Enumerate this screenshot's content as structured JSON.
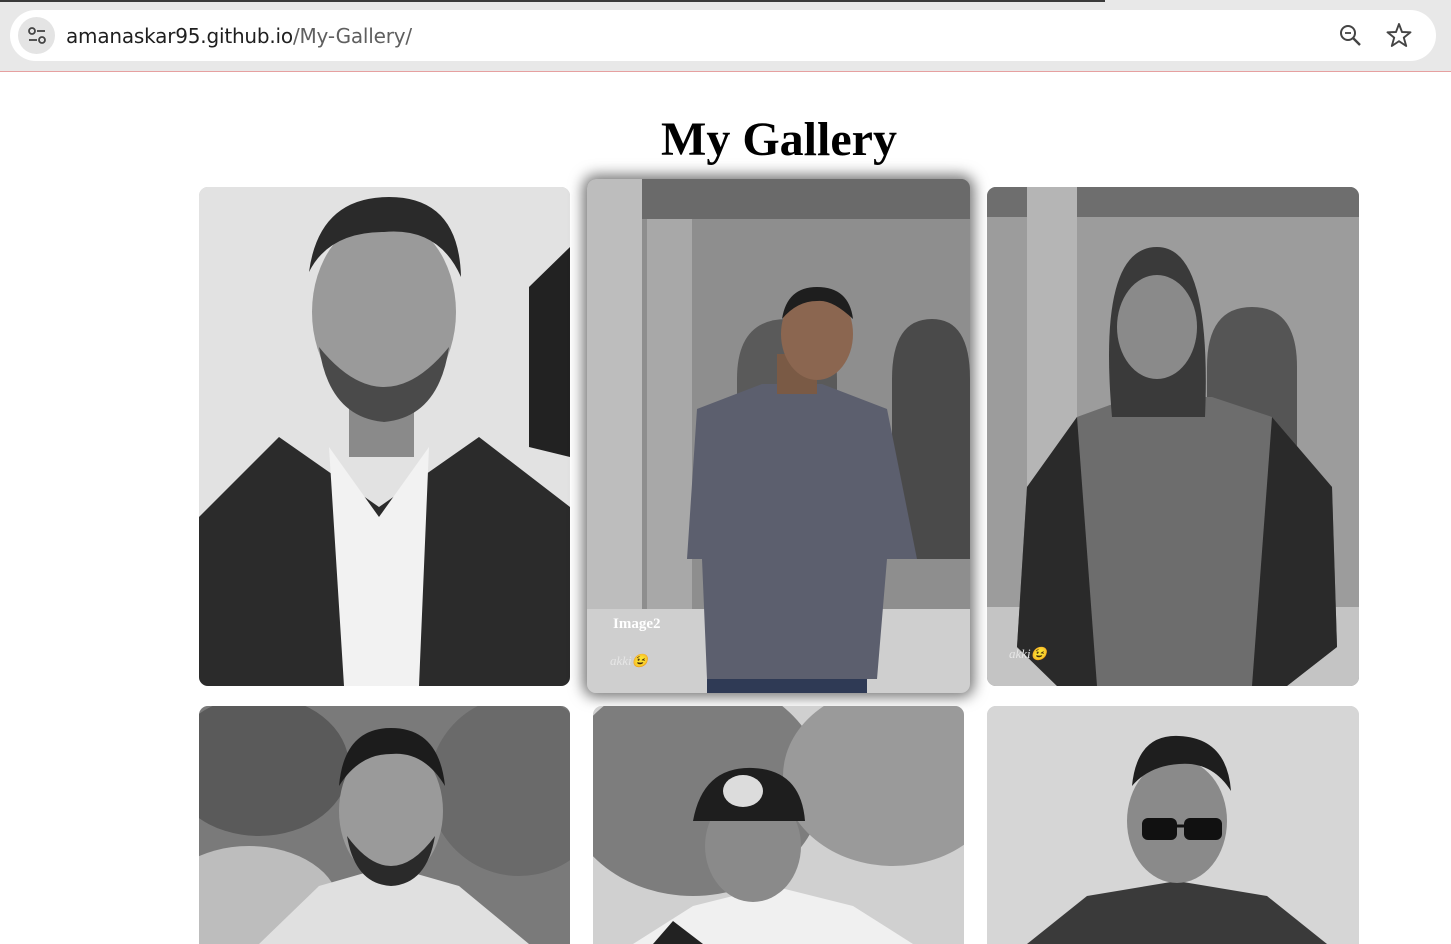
{
  "browser": {
    "url_host": "amanaskar95.github.io",
    "url_path": "/My-Gallery/",
    "icons": [
      "site-info-icon",
      "zoom-icon",
      "bookmark-star-icon"
    ]
  },
  "page": {
    "title": "My Gallery"
  },
  "gallery": {
    "items": [
      {
        "name": "photo-1"
      },
      {
        "name": "photo-2",
        "caption_title": "Image2",
        "caption_sub": "akki😉"
      },
      {
        "name": "photo-3",
        "caption_sub": "akki😉"
      },
      {
        "name": "photo-4"
      },
      {
        "name": "photo-5"
      },
      {
        "name": "photo-6"
      }
    ]
  }
}
